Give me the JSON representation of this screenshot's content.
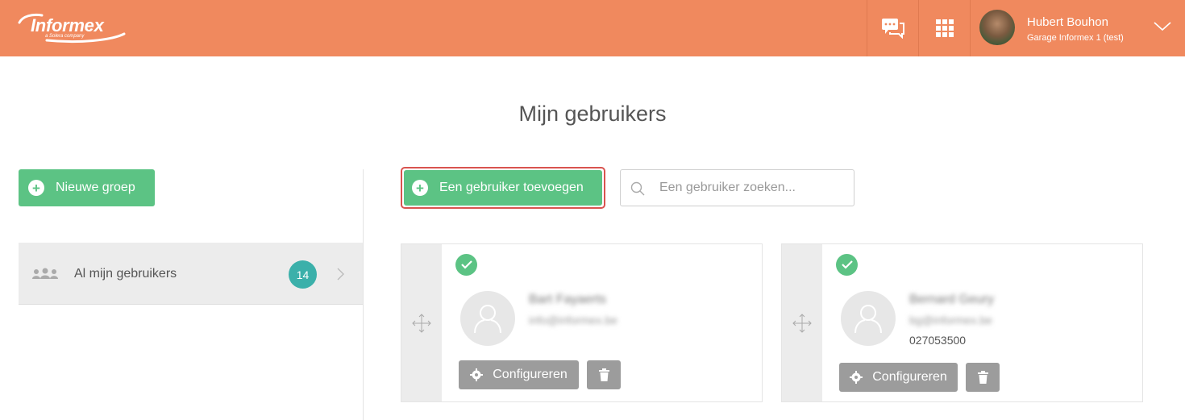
{
  "header": {
    "logo_text": "Informex",
    "logo_sub": "a Solera company",
    "user_name": "Hubert Bouhon",
    "user_garage": "Garage Informex 1 (test)",
    "icons": [
      "chat-icon",
      "apps-grid-icon",
      "chevron-down-icon"
    ]
  },
  "page": {
    "title": "Mijn gebruikers"
  },
  "left": {
    "new_group_label": "Nieuwe groep",
    "groups": [
      {
        "label": "Al mijn gebruikers",
        "count": "14"
      }
    ]
  },
  "toolbar": {
    "add_user_label": "Een gebruiker toevoegen",
    "search_placeholder": "Een gebruiker zoeken..."
  },
  "users": [
    {
      "name": "Bart Fayaerts",
      "email": "info@informex.be",
      "phone": "",
      "configure_label": "Configureren",
      "active": true
    },
    {
      "name": "Bernard Geury",
      "email": "bg@informex.be",
      "phone": "027053500",
      "configure_label": "Configureren",
      "active": true
    }
  ],
  "colors": {
    "header": "#f0895e",
    "accent_green": "#5cc384",
    "badge_teal": "#3bb0aa",
    "highlight_red": "#d9534f",
    "button_grey": "#9c9c9c"
  }
}
